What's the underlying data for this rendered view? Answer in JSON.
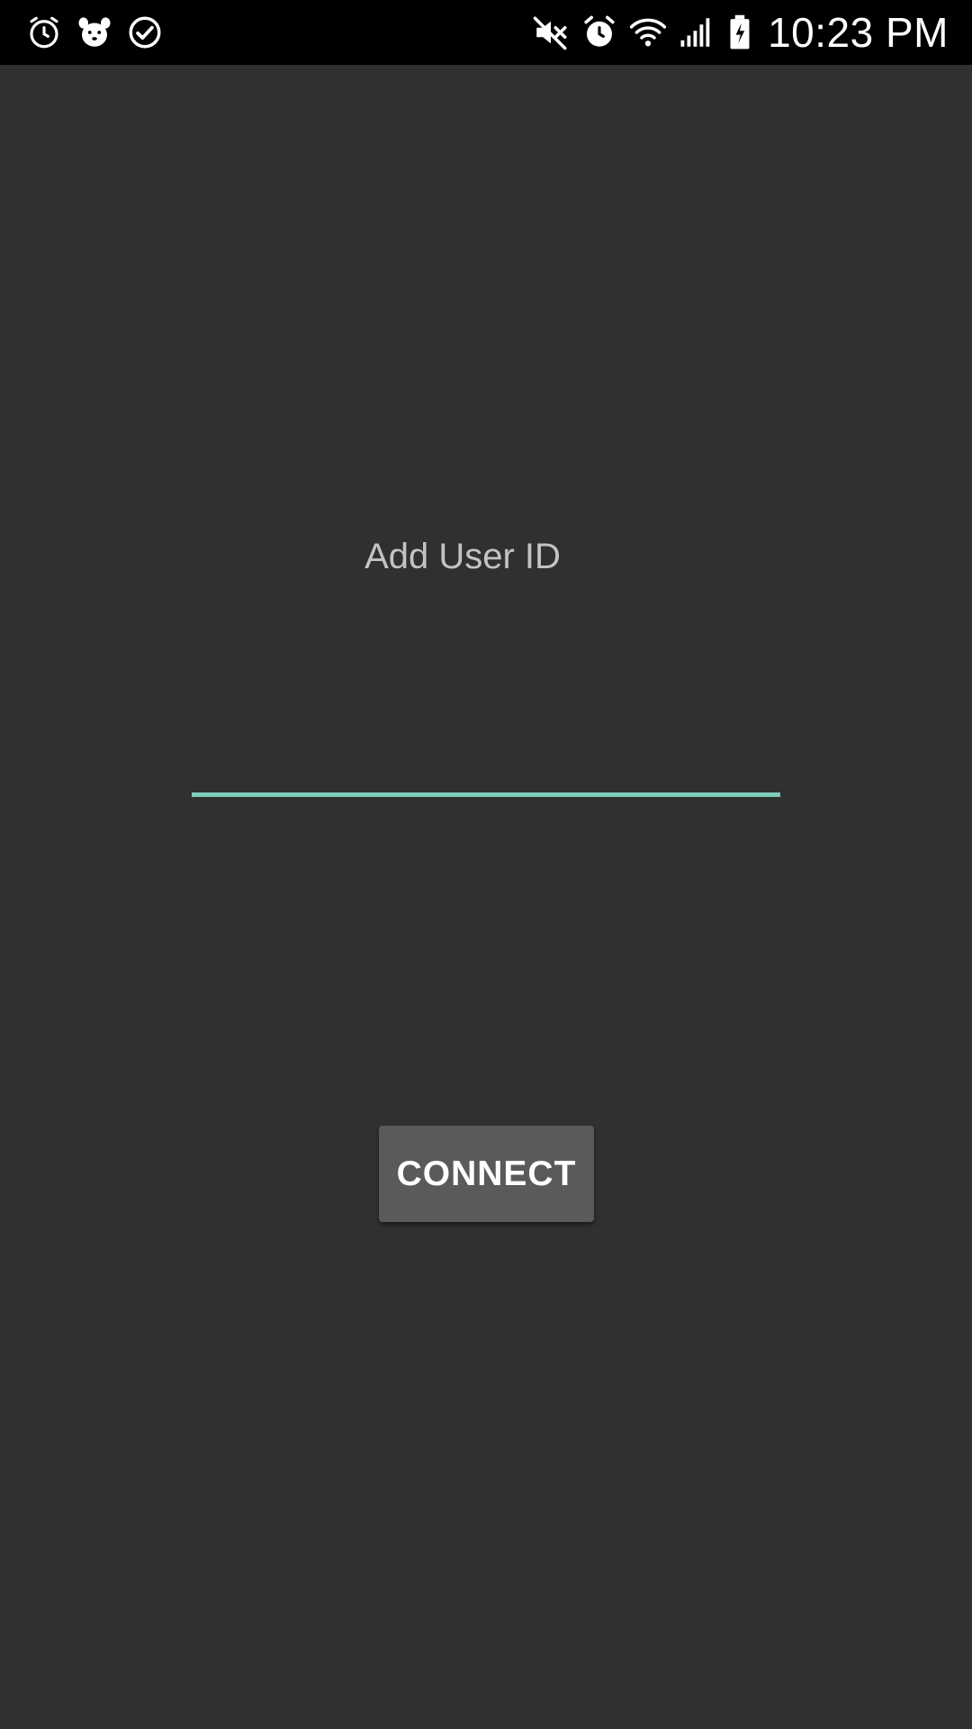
{
  "status_bar": {
    "time": "10:23 PM",
    "left_icons": [
      "alarm-clock-icon",
      "dog-face-icon",
      "check-circle-icon"
    ],
    "right_icons": [
      "mute-icon",
      "alarm-icon",
      "wifi-icon",
      "signal-icon",
      "battery-charging-icon"
    ]
  },
  "main": {
    "user_id_label": "Add User ID",
    "user_id_value": "",
    "connect_label": "CONNECT"
  },
  "colors": {
    "background": "#303030",
    "status_bar": "#000000",
    "field_underline": "#7fcbbc",
    "button": "#5a5a5c",
    "label_text": "#c3c3c3"
  }
}
